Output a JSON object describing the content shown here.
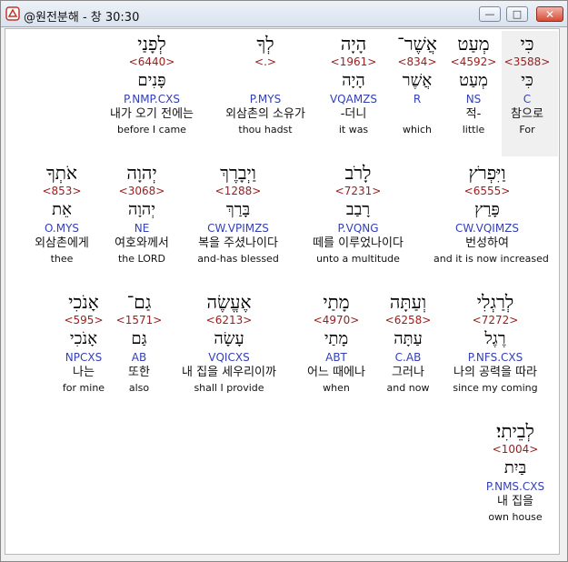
{
  "window": {
    "title": "@원전분해 - 창 30:30",
    "min_label": "—",
    "max_label": "□",
    "close_label": "✕"
  },
  "rows": [
    [
      {
        "heb": "כִּי",
        "strong": "<3588>",
        "lemma": "כִּי",
        "morph": "C",
        "korean": "참으로",
        "english": "For"
      },
      {
        "heb": "מְעַט",
        "strong": "<4592>",
        "lemma": "מְעַט",
        "morph": "NS",
        "korean": "적-",
        "english": "little"
      },
      {
        "heb": "אֲשֶׁר־",
        "strong": "<834>",
        "lemma": "אֲשֶׁר",
        "morph": "R",
        "korean": "",
        "english": "which"
      },
      {
        "heb": "הָיָה",
        "strong": "<1961>",
        "lemma": "הָיָה",
        "morph": "VQAMZS",
        "korean": "-더니",
        "english": "it was"
      },
      {
        "heb": "לְךָ",
        "strong": "<.>",
        "lemma": "",
        "morph": "P.MYS",
        "korean": "외삼촌의 소유가",
        "english": "thou hadst"
      },
      {
        "heb": "לְפָנַי",
        "strong": "<6440>",
        "lemma": "פָּנִים",
        "morph": "P.NMP.CXS",
        "korean": "내가 오기 전에는",
        "english": "before I came"
      }
    ],
    [
      {
        "heb": "וַיִּפְרֹץ",
        "strong": "<6555>",
        "lemma": "פָּרַץ",
        "morph": "CW.VQIMZS",
        "korean": "번성하여",
        "english": "and it is now increased"
      },
      {
        "heb": "לָרֹב",
        "strong": "<7231>",
        "lemma": "רָבַב",
        "morph": "P.VQNG",
        "korean": "떼를 이루었나이다",
        "english": "unto a multitude"
      },
      {
        "heb": "וַיְבָרֶךְ",
        "strong": "<1288>",
        "lemma": "בָּרַךְ",
        "morph": "CW.VPIMZS",
        "korean": "복을 주셨나이다",
        "english": "and-has blessed"
      },
      {
        "heb": "יְהוָה",
        "strong": "<3068>",
        "lemma": "יְהוָה",
        "morph": "NE",
        "korean": "여호와께서",
        "english": "the LORD"
      },
      {
        "heb": "אֹתְךָ",
        "strong": "<853>",
        "lemma": "אֵת",
        "morph": "O.MYS",
        "korean": "외삼촌에게",
        "english": "thee"
      }
    ],
    [
      {
        "heb": "לְרַגְלִי",
        "strong": "<7272>",
        "lemma": "רֶגֶל",
        "morph": "P.NFS.CXS",
        "korean": "나의 공력을 따라",
        "english": "since my coming"
      },
      {
        "heb": "וְעַתָּה",
        "strong": "<6258>",
        "lemma": "עַתָּה",
        "morph": "C.AB",
        "korean": "그러나",
        "english": "and now"
      },
      {
        "heb": "מָתַי",
        "strong": "<4970>",
        "lemma": "מָתַי",
        "morph": "ABT",
        "korean": "어느 때에나",
        "english": "when"
      },
      {
        "heb": "אֶעֱשֶׂה",
        "strong": "<6213>",
        "lemma": "עָשָׂה",
        "morph": "VQICXS",
        "korean": "내 집을 세우리이까",
        "english": "shall I provide"
      },
      {
        "heb": "גַם־",
        "strong": "<1571>",
        "lemma": "גַּם",
        "morph": "AB",
        "korean": "또한",
        "english": "also"
      },
      {
        "heb": "אָנֹכִי",
        "strong": "<595>",
        "lemma": "אָנֹכִי",
        "morph": "NPCXS",
        "korean": "나는",
        "english": "for mine"
      }
    ],
    [
      {
        "heb": "לְבֵיתִי׃",
        "strong": "<1004>",
        "lemma": "בַּיִת",
        "morph": "P.NMS.CXS",
        "korean": "내 집을",
        "english": "own house"
      }
    ]
  ]
}
